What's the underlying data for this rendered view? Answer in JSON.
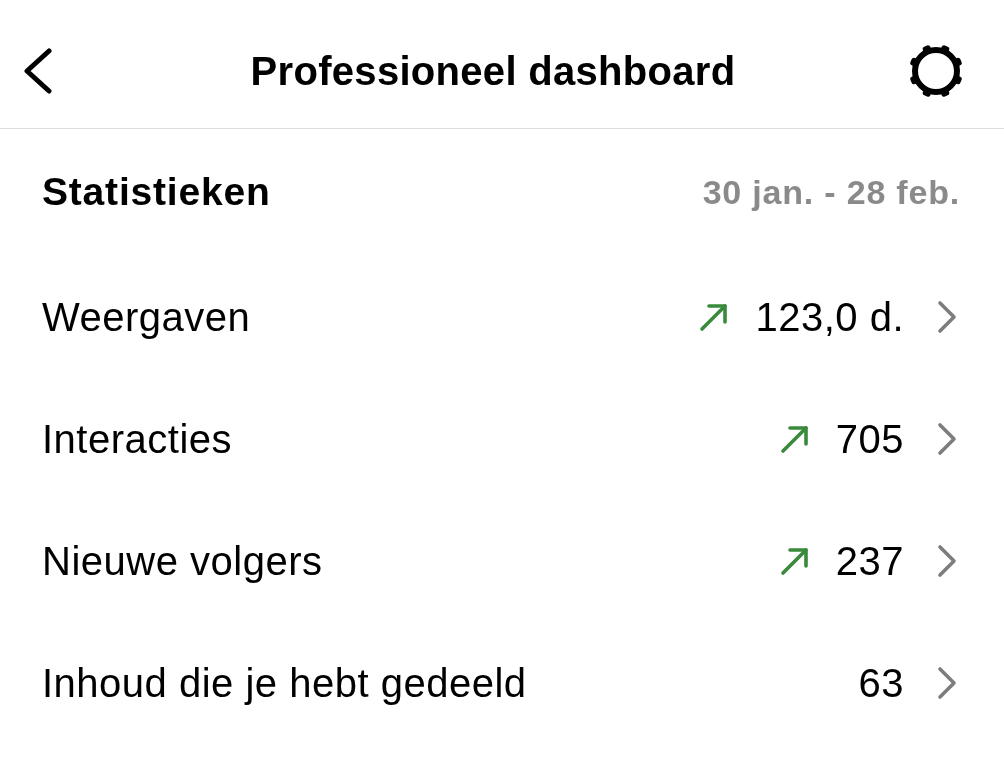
{
  "header": {
    "title": "Professioneel dashboard"
  },
  "statistics": {
    "title": "Statistieken",
    "date_range": "30 jan. - 28 feb."
  },
  "rows": [
    {
      "label": "Weergaven",
      "value": "123,0 d.",
      "trend_up": true
    },
    {
      "label": "Interacties",
      "value": "705",
      "trend_up": true
    },
    {
      "label": "Nieuwe volgers",
      "value": "237",
      "trend_up": true
    },
    {
      "label": "Inhoud die je hebt gedeeld",
      "value": "63",
      "trend_up": false
    }
  ]
}
